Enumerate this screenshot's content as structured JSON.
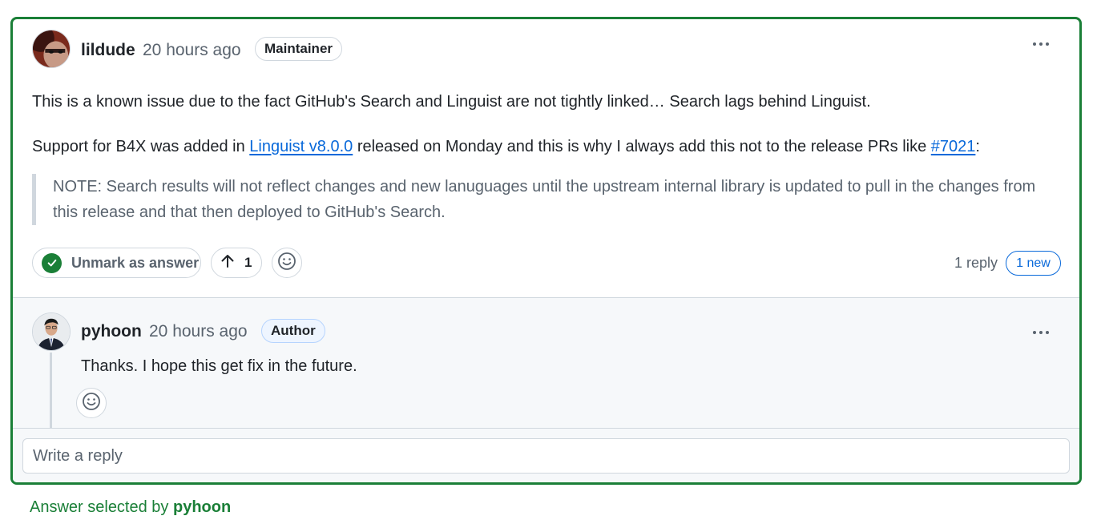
{
  "main_comment": {
    "author": "lildude",
    "timestamp": "20 hours ago",
    "role": "Maintainer",
    "paragraph1": "This is a known issue due to the fact GitHub's Search and Linguist are not tightly linked… Search lags behind Linguist.",
    "paragraph2": {
      "prefix": "Support for B4X was added in ",
      "link1": "Linguist v8.0.0",
      "middle": " released on Monday and this is why I always add this not to the release PRs like ",
      "link2": "#7021",
      "suffix": ":"
    },
    "quote": "NOTE: Search results will not reflect changes and new lanuguages until the upstream internal library is updated to pull in the changes from this release and that then deployed to GitHub's Search.",
    "unmark_label": "Unmark as answer",
    "upvotes": "1",
    "reply_count": "1 reply",
    "new_badge": "1 new"
  },
  "reply": {
    "author": "pyhoon",
    "timestamp": "20 hours ago",
    "role": "Author",
    "text": "Thanks. I hope this get fix in the future."
  },
  "reply_input": {
    "placeholder": "Write a reply"
  },
  "footer": {
    "prefix": "Answer selected by",
    "user": "pyhoon"
  },
  "icons": {
    "avatar_main": "avatar-photo",
    "avatar_reply": "avatar-photo",
    "check": "check-circle-icon",
    "upvote": "arrow-up-icon",
    "emoji": "smiley-icon",
    "more": "kebab-horizontal-icon"
  },
  "colors": {
    "answer_border": "#1a7f37",
    "link": "#0969da",
    "muted": "#59636e",
    "reply_bg": "#f6f8fa"
  }
}
